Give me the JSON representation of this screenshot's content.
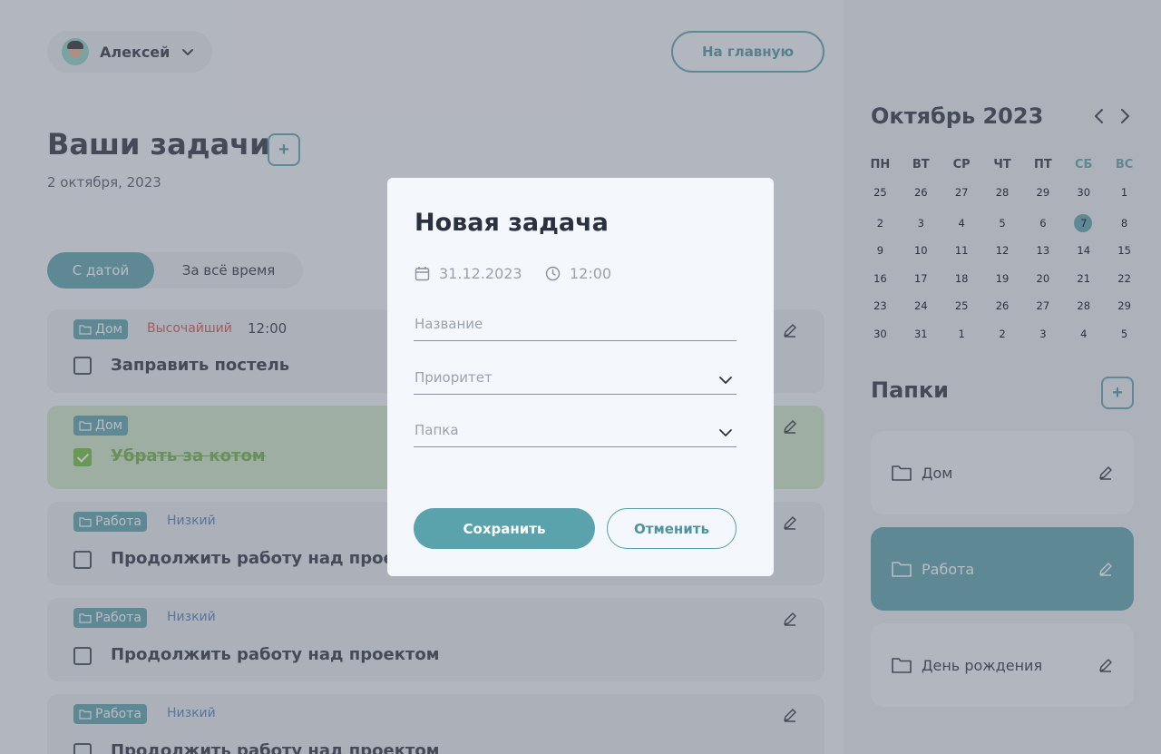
{
  "header": {
    "user_name": "Алексей",
    "home_label": "На главную"
  },
  "main": {
    "title": "Ваши задачи",
    "date": "2 октября, 2023",
    "add_symbol": "+",
    "filters": [
      "С датой",
      "За всё время"
    ],
    "tasks": [
      {
        "folder": "Дом",
        "priority": "Высочайший",
        "time": "12:00",
        "title": "Заправить постель",
        "done": false
      },
      {
        "folder": "Дом",
        "priority": "",
        "time": "",
        "title": "Убрать за котом",
        "done": true
      },
      {
        "folder": "Работа",
        "priority": "Низкий",
        "time": "",
        "title": "Продолжить работу над проектом",
        "done": false
      },
      {
        "folder": "Работа",
        "priority": "Низкий",
        "time": "",
        "title": "Продолжить работу над проектом",
        "done": false
      },
      {
        "folder": "Работа",
        "priority": "Низкий",
        "time": "",
        "title": "Продолжить работу над проектом",
        "done": false
      }
    ]
  },
  "calendar": {
    "month": "Октябрь 2023",
    "weekdays": [
      "ПН",
      "ВТ",
      "СР",
      "ЧТ",
      "ПТ",
      "СБ",
      "ВС"
    ],
    "weeks": [
      [
        "25",
        "26",
        "27",
        "28",
        "29",
        "30",
        "1"
      ],
      [
        "2",
        "3",
        "4",
        "5",
        "6",
        "7",
        "8"
      ],
      [
        "9",
        "10",
        "11",
        "12",
        "13",
        "14",
        "15"
      ],
      [
        "16",
        "17",
        "18",
        "19",
        "20",
        "21",
        "22"
      ],
      [
        "23",
        "24",
        "25",
        "26",
        "27",
        "28",
        "29"
      ],
      [
        "30",
        "31",
        "1",
        "2",
        "3",
        "4",
        "5"
      ]
    ],
    "selected_day": "7"
  },
  "folders": {
    "title": "Папки",
    "add_symbol": "+",
    "items": [
      {
        "name": "Дом",
        "active": false
      },
      {
        "name": "Работа",
        "active": true
      },
      {
        "name": "День рождения",
        "active": false
      }
    ]
  },
  "modal": {
    "title": "Новая задача",
    "date": "31.12.2023",
    "time": "12:00",
    "name_placeholder": "Название",
    "priority_placeholder": "Приоритет",
    "folder_placeholder": "Папка",
    "save_label": "Сохранить",
    "cancel_label": "Отменить"
  },
  "colors": {
    "accent": "#5aa3ad",
    "priority_high": "#d04f4f",
    "priority_low": "#4c7fb7",
    "done_bg": "#cfe6c9",
    "check_green": "#6cbf3f"
  },
  "icons": {
    "user_menu": "chevron-down-icon",
    "task_edit": "pencil-icon",
    "folder": "folder-icon",
    "calendar_prev": "chevron-left-icon",
    "calendar_next": "chevron-right-icon",
    "modal_date": "calendar-icon",
    "modal_time": "clock-icon"
  }
}
